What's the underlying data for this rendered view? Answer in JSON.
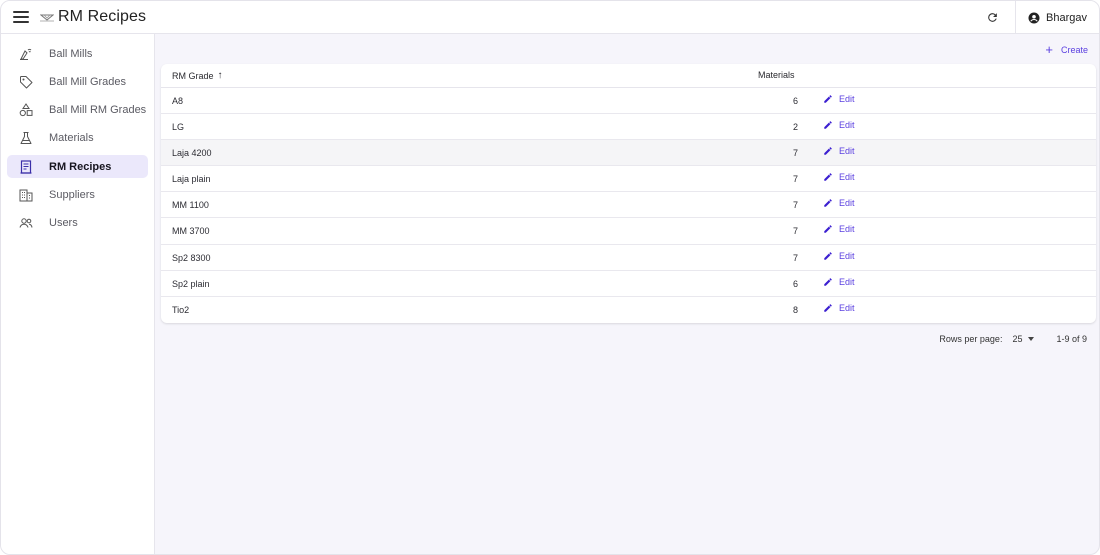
{
  "app": {
    "title": "RM Recipes"
  },
  "header": {
    "user_name": "Bhargav"
  },
  "sidebar": {
    "items": [
      {
        "label": "Ball Mills",
        "icon": "ball-mill-icon",
        "active": false
      },
      {
        "label": "Ball Mill Grades",
        "icon": "tag-icon",
        "active": false
      },
      {
        "label": "Ball Mill RM Grades",
        "icon": "shapes-icon",
        "active": false
      },
      {
        "label": "Materials",
        "icon": "flask-icon",
        "active": false
      },
      {
        "label": "RM Recipes",
        "icon": "receipt-icon",
        "active": true
      },
      {
        "label": "Suppliers",
        "icon": "building-icon",
        "active": false
      },
      {
        "label": "Users",
        "icon": "users-icon",
        "active": false
      }
    ]
  },
  "toolbar": {
    "create_label": "Create"
  },
  "table": {
    "columns": {
      "grade": "RM Grade",
      "materials": "Materials"
    },
    "sort_indicator": "↑",
    "edit_label": "Edit",
    "rows": [
      {
        "grade": "A8",
        "materials": "6"
      },
      {
        "grade": "LG",
        "materials": "2"
      },
      {
        "grade": "Laja 4200",
        "materials": "7"
      },
      {
        "grade": "Laja plain",
        "materials": "7"
      },
      {
        "grade": "MM 1100",
        "materials": "7"
      },
      {
        "grade": "MM 3700",
        "materials": "7"
      },
      {
        "grade": "Sp2 8300",
        "materials": "7"
      },
      {
        "grade": "Sp2 plain",
        "materials": "6"
      },
      {
        "grade": "Tio2",
        "materials": "8"
      }
    ]
  },
  "pagination": {
    "rows_per_page_label": "Rows per page:",
    "rows_per_page": "25",
    "range": "1-9 of 9"
  },
  "colors": {
    "accent": "#5a3fe0",
    "active_bg": "#ebe8fb",
    "page_bg": "#f6f5fb"
  }
}
